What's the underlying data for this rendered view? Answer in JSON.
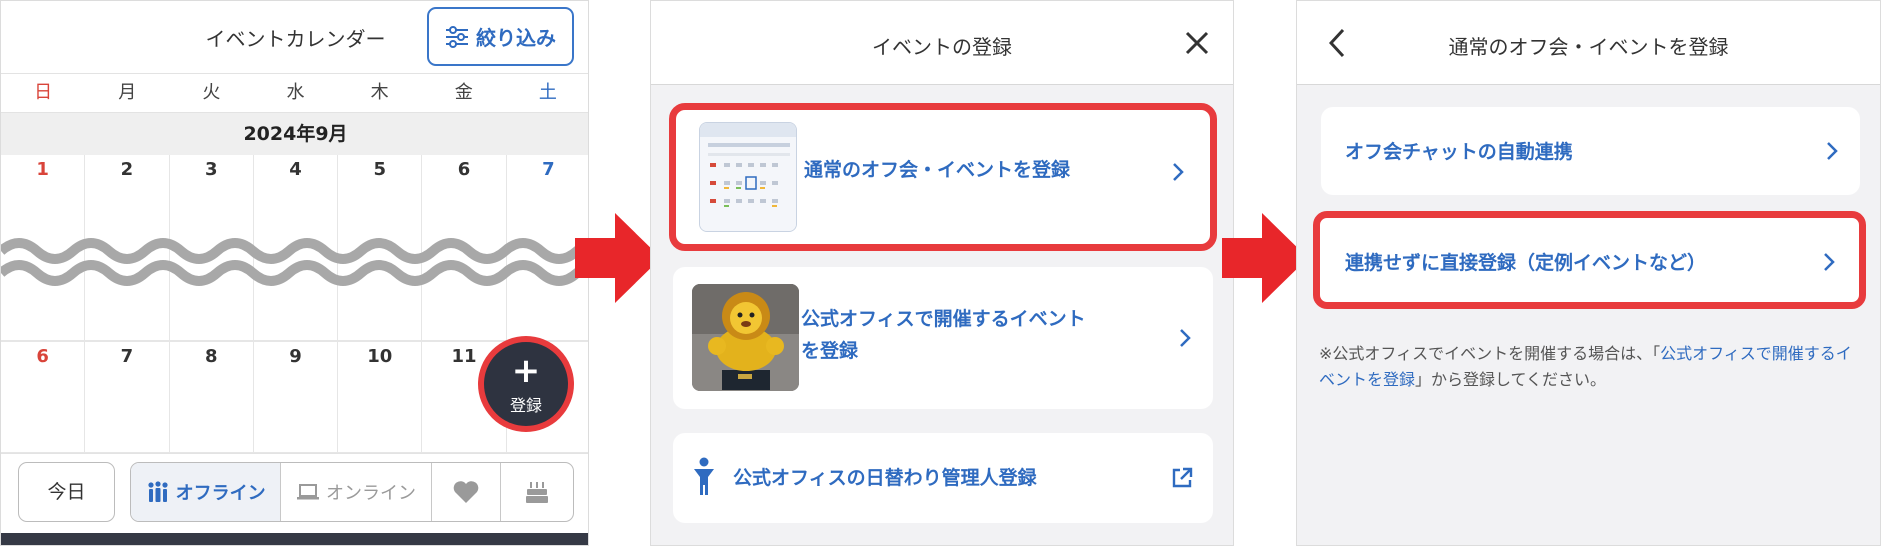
{
  "panel1": {
    "title": "イベントカレンダー",
    "filter_label": "絞り込み",
    "weekdays": [
      "日",
      "月",
      "火",
      "水",
      "木",
      "金",
      "土"
    ],
    "month_label": "2024年9月",
    "week1": [
      "1",
      "2",
      "3",
      "4",
      "5",
      "6",
      "7"
    ],
    "week2": [
      "6",
      "7",
      "8",
      "9",
      "10",
      "11",
      ""
    ],
    "fab_label": "登録",
    "today_label": "今日",
    "segments": {
      "offline": "オフライン",
      "online": "オンライン"
    }
  },
  "panel2": {
    "title": "イベントの登録",
    "option1": "通常のオフ会・イベントを登録",
    "option2_line1": "公式オフィスで開催するイベント",
    "option2_line2": "を登録",
    "option3": "公式オフィスの日替わり管理人登録"
  },
  "panel3": {
    "title": "通常のオフ会・イベントを登録",
    "option1": "オフ会チャットの自動連携",
    "option2": "連携せずに直接登録（定例イベントなど）",
    "note_prefix": "※公式オフィスでイベントを開催する場合は、「",
    "note_link": "公式オフィスで開催するイベントを登録",
    "note_suffix": "」から登録してください。"
  },
  "colors": {
    "accent_blue": "#2f6bc0",
    "highlight_red": "#e83b3d",
    "arrow_red": "#e8262a",
    "dark": "#2e3340"
  },
  "icons": [
    "filter-icon",
    "plus-icon",
    "offline-people-icon",
    "laptop-icon",
    "heart-icon",
    "birthday-cake-icon",
    "close-icon",
    "chevron-right-icon",
    "person-icon",
    "external-link-icon",
    "back-chevron-icon"
  ]
}
